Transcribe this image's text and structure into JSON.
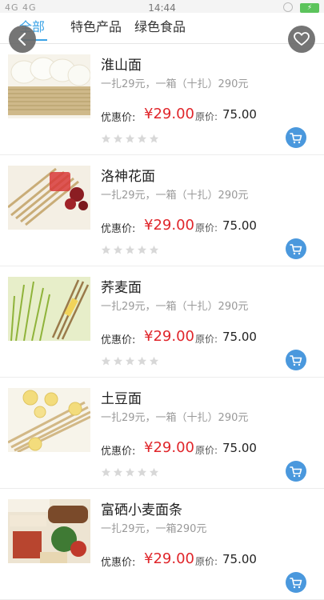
{
  "status_bar": {
    "signal": "4G 4G",
    "time": "14:44"
  },
  "tabs": [
    {
      "label": "全部",
      "active": true
    },
    {
      "label": "特色产品",
      "active": false
    },
    {
      "label": "绿色食品",
      "active": false
    }
  ],
  "buttons": {
    "back_icon": "chevron-left-icon",
    "favorite_icon": "heart-icon",
    "cart_icon": "cart-icon"
  },
  "labels": {
    "sale_price": "优惠价:",
    "original_price": "原价:"
  },
  "products": [
    {
      "name": "淮山面",
      "desc": "一扎29元，一箱（十扎）290元",
      "price": "¥29.00",
      "original": "75.00",
      "rating": 0,
      "image": "yam-noodles"
    },
    {
      "name": "洛神花面",
      "desc": "一扎29元，一箱（十扎）290元",
      "price": "¥29.00",
      "original": "75.00",
      "rating": 0,
      "image": "roselle-noodles"
    },
    {
      "name": "荞麦面",
      "desc": "一扎29元，一箱（十扎）290元",
      "price": "¥29.00",
      "original": "75.00",
      "rating": 0,
      "image": "buckwheat-noodles"
    },
    {
      "name": "土豆面",
      "desc": "一扎29元，一箱（十扎）290元",
      "price": "¥29.00",
      "original": "75.00",
      "rating": 0,
      "image": "potato-noodles"
    },
    {
      "name": "富硒小麦面条",
      "desc": "一扎29元，一箱290元",
      "price": "¥29.00",
      "original": "75.00",
      "rating": 0,
      "image": "selenium-wheat-noodles"
    }
  ],
  "colors": {
    "accent": "#3ba3e6",
    "price": "#e0262b",
    "cart": "#4a98dd"
  }
}
